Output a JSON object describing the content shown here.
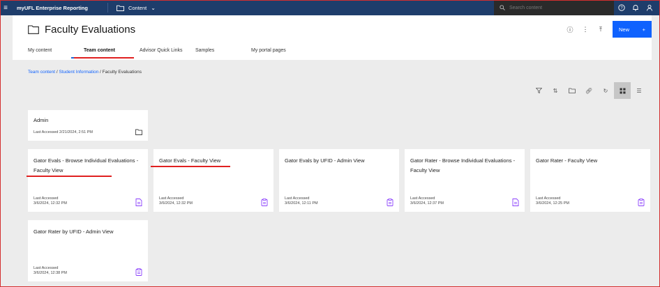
{
  "topbar": {
    "menu_glyph": "≡",
    "app_title": "myUFL Enterprise Reporting",
    "content_label": "Content",
    "search_placeholder": "Search content"
  },
  "header": {
    "title": "Faculty Evaluations",
    "tabs": [
      "My content",
      "Team content",
      "Advisor Quick Links",
      "Samples",
      "My portal pages"
    ],
    "active_tab": "Team content",
    "new_label": "New",
    "new_plus": "+"
  },
  "breadcrumb": {
    "items": [
      "Team content",
      "Student Information"
    ],
    "current": "Faculty Evaluations",
    "separator": "/"
  },
  "cards": [
    {
      "title": "Admin",
      "meta": "Last Accessed 2/21/2024, 2:51 PM",
      "icon": "folder-icon"
    },
    {
      "title": "Gator Evals - Browse Individual Evaluations - Faculty View",
      "meta_label": "Last Accessed",
      "meta_date": "3/6/2024, 12:32 PM",
      "icon": "report-icon"
    },
    {
      "title": "Gator Evals - Faculty View",
      "meta_label": "Last Accessed",
      "meta_date": "3/6/2024, 12:32 PM",
      "icon": "clipboard-icon"
    },
    {
      "title": "Gator Evals by UFID - Admin View",
      "meta_label": "Last Accessed",
      "meta_date": "3/6/2024, 12:11 PM",
      "icon": "clipboard-icon"
    },
    {
      "title": "Gator Rater - Browse Individual Evaluations - Faculty View",
      "meta_label": "Last Accessed",
      "meta_date": "3/6/2024, 12:37 PM",
      "icon": "report-icon"
    },
    {
      "title": "Gator Rater - Faculty View",
      "meta_label": "Last Accessed",
      "meta_date": "3/6/2024, 12:25 PM",
      "icon": "clipboard-icon"
    },
    {
      "title": "Gator Rater by UFID - Admin View",
      "meta_label": "Last Accessed",
      "meta_date": "3/6/2024, 12:38 PM",
      "icon": "clipboard-icon"
    }
  ],
  "colors": {
    "topbar": "#1e3d6b",
    "accent": "#0f62fe",
    "card_icon": "#8a3ffc",
    "annotation": "#e02020"
  }
}
